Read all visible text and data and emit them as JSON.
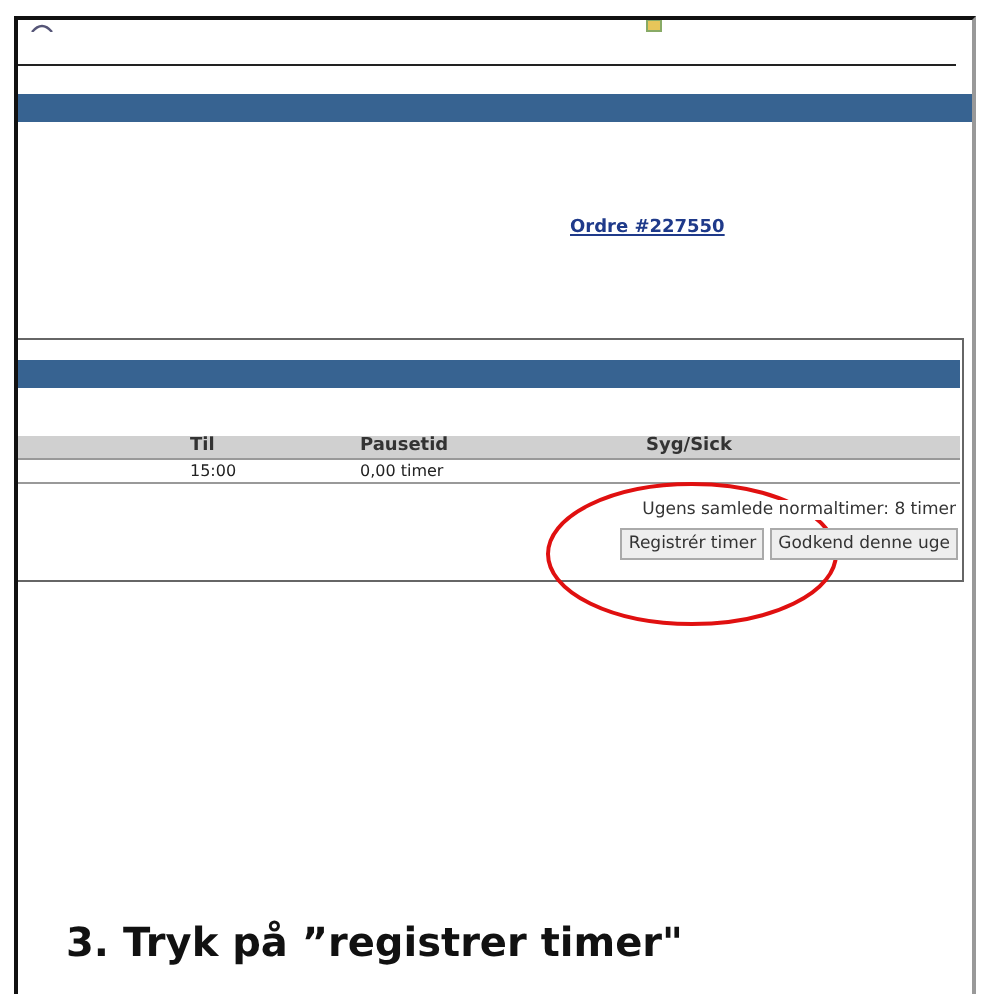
{
  "order_link": "Ordre #227550",
  "table": {
    "columns": [
      "Til",
      "Pausetid",
      "Syg/Sick"
    ],
    "rows": [
      [
        "15:00",
        "0,00 timer",
        ""
      ]
    ]
  },
  "summary": "Ugens samlede normaltimer: 8 timer",
  "buttons": [
    "Registrér timer",
    "Godkend denne uge"
  ],
  "caption": "3. Tryk på ”registrer timer\""
}
